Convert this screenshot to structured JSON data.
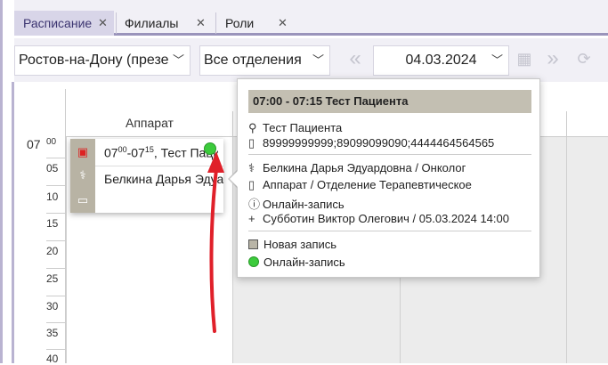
{
  "tabs": [
    {
      "label": "Расписание",
      "active": true,
      "closable": true
    },
    {
      "label": "Филиалы",
      "active": false,
      "closable": true
    },
    {
      "label": "Роли",
      "active": false,
      "closable": true
    }
  ],
  "toolbar": {
    "branch_value": "Ростов-на-Дону (презе",
    "department_value": "Все отделения",
    "date_value": "04.03.2024"
  },
  "schedule": {
    "column_header": "Аппарат",
    "hour_label": "07",
    "minute_labels": [
      "00",
      "05",
      "10",
      "15",
      "20",
      "25",
      "30",
      "35",
      "40"
    ]
  },
  "appointment_card": {
    "time_start_h": "07",
    "time_start_m": "00",
    "time_end_h": "07",
    "time_end_m": "15",
    "patient_short": ", Тест Паци",
    "doctor": "Белкина Дарья Эдуардовна"
  },
  "popup": {
    "title": "07:00 - 07:15 Тест Пациента",
    "patient": "Тест Пациента",
    "phones": "89999999999;89099099090;4444464564565",
    "doctor": "Белкина Дарья Эдуардовна / Онколог",
    "resource": "Аппарат / Отделение Терапевтическое",
    "source": "Онлайн-запись",
    "created": "Субботин Виктор Олегович / 05.03.2024 14:00",
    "legend": [
      {
        "label": "Новая запись",
        "kind": "status-square"
      },
      {
        "label": "Онлайн-запись",
        "kind": "green-dot"
      }
    ]
  },
  "colors": {
    "accent": "#9a94bb",
    "tab_active": "#d8d5e8",
    "card_strip": "#b8b3a4",
    "popup_title": "#c3bfb2",
    "online_green": "#3ccb3c",
    "arrow_red": "#e0202a"
  }
}
